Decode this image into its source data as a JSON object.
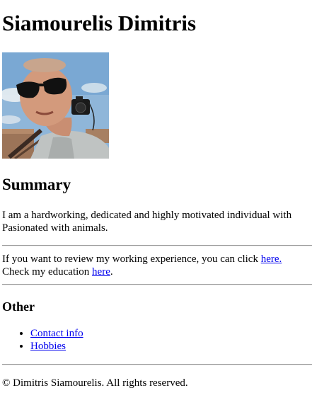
{
  "header": {
    "name": "Siamourelis Dimitris"
  },
  "profile_photo": {
    "alt": "profile-photo"
  },
  "summary": {
    "heading": "Summary",
    "line1": "I am a hardworking, dedicated and highly motivated individual with",
    "line2": "Pasionated with animals."
  },
  "review": {
    "line1_prefix": "If you want to review my working experience, you can click ",
    "line1_link": "here.",
    "line2_prefix": "Check my education ",
    "line2_link": "here",
    "line2_suffix": "."
  },
  "other": {
    "heading": "Other",
    "items": [
      {
        "label": "Contact info"
      },
      {
        "label": "Hobbies"
      }
    ]
  },
  "footer": {
    "text": "© Dimitris Siamourelis. All rights reserved."
  }
}
